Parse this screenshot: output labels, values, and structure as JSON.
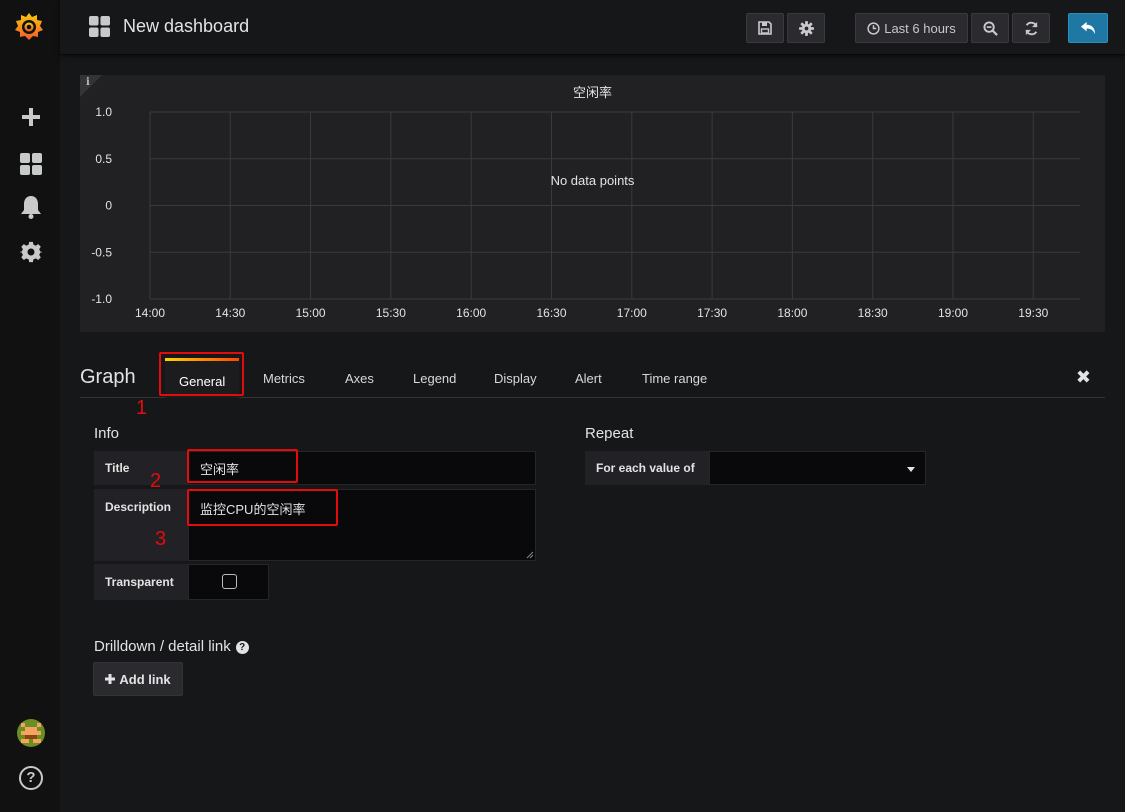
{
  "navbar": {
    "title": "New dashboard",
    "time_range": "Last 6 hours"
  },
  "panel": {
    "title": "空闲率",
    "no_data": "No data points"
  },
  "chart_data": {
    "type": "line",
    "title": "空闲率",
    "y_ticks": [
      "1.0",
      "0.5",
      "0",
      "-0.5",
      "-1.0"
    ],
    "x_ticks": [
      "14:00",
      "14:30",
      "15:00",
      "15:30",
      "16:00",
      "16:30",
      "17:00",
      "17:30",
      "18:00",
      "18:30",
      "19:00",
      "19:30"
    ],
    "ylim": [
      -1.0,
      1.0
    ],
    "grid": true,
    "series": []
  },
  "editor": {
    "title": "Graph",
    "tabs": [
      "General",
      "Metrics",
      "Axes",
      "Legend",
      "Display",
      "Alert",
      "Time range"
    ],
    "active_tab": "General"
  },
  "info": {
    "heading": "Info",
    "title_label": "Title",
    "title_value": "空闲率",
    "description_label": "Description",
    "description_value": "监控CPU的空闲率",
    "transparent_label": "Transparent"
  },
  "repeat": {
    "heading": "Repeat",
    "for_each_label": "For each value of",
    "for_each_value": ""
  },
  "drilldown": {
    "heading": "Drilldown / detail link",
    "add_link": "Add link"
  },
  "annotations": [
    "1",
    "2",
    "3"
  ],
  "colors": {
    "accent_blue": "#1f78a4",
    "annotation_red": "#e30b0b",
    "grafana_orange": "#f05a28"
  }
}
